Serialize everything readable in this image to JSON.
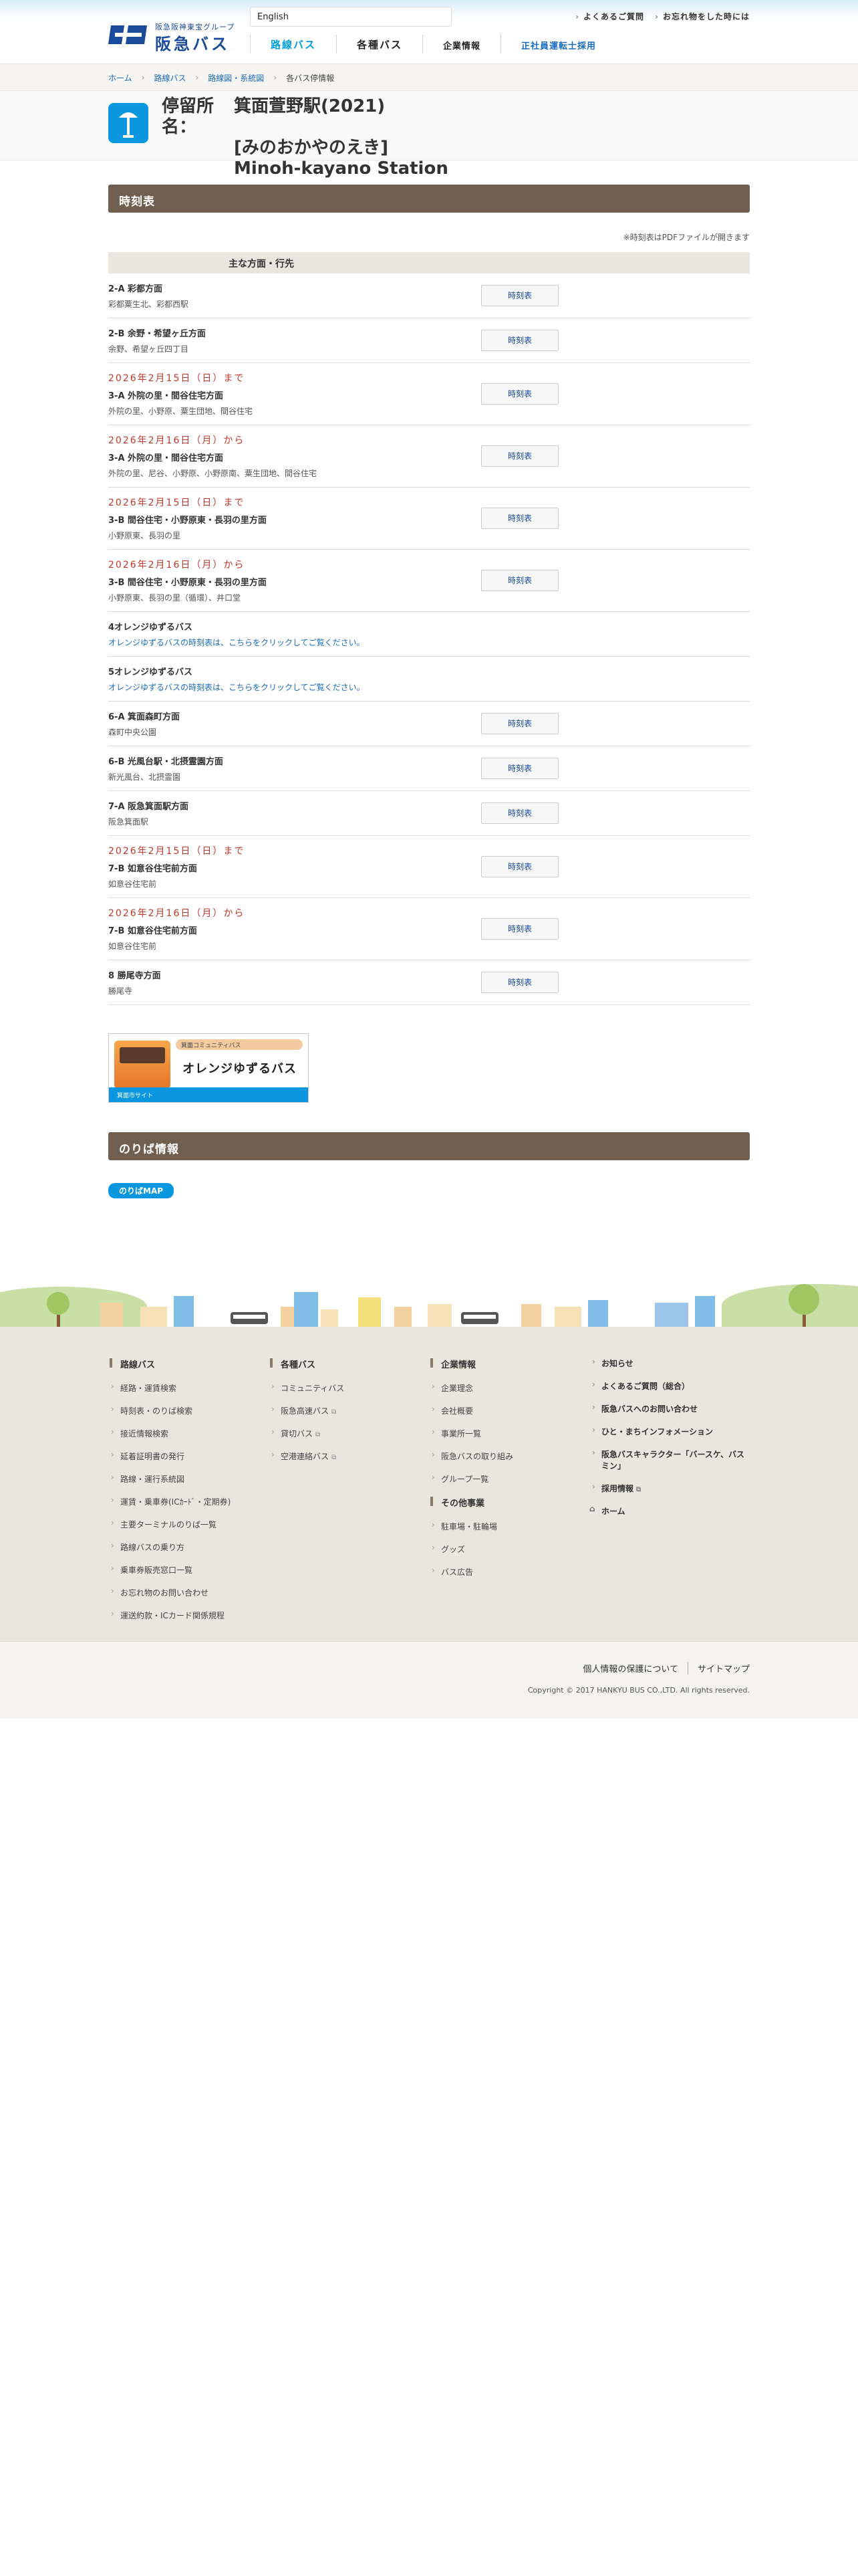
{
  "header": {
    "logo_sub": "阪急阪神東宝グループ",
    "logo_name": "阪急バス",
    "logo_mark": "HANKYU",
    "language": "English",
    "top_links": [
      "よくあるご質問",
      "お忘れ物をした時には"
    ],
    "nav": [
      "路線バス",
      "各種バス",
      "企業情報",
      "正社員運転士採用"
    ]
  },
  "breadcrumb": [
    "ホーム",
    "路線バス",
    "路線図・系統図",
    "各バス停情報"
  ],
  "stop": {
    "prefix": "停留所名：",
    "name": "箕面萱野駅(2021)",
    "kana": "[みのおかやのえき]",
    "english": "Minoh-kayano Station"
  },
  "timetable": {
    "heading": "時刻表",
    "pdf_note": "※時刻表はPDFファイルが開きます",
    "col_header": "主な方面・行先",
    "button_label": "時刻表",
    "rows": [
      {
        "date": "",
        "route": "2-A 彩都方面",
        "stops": "彩都粟生北、彩都西駅",
        "button": true
      },
      {
        "date": "",
        "route": "2-B 余野・希望ヶ丘方面",
        "stops": "余野、希望ヶ丘四丁目",
        "button": true
      },
      {
        "date": "2026年2月15日（日）まで",
        "route": "3-A 外院の里・間谷住宅方面",
        "stops": "外院の里、小野原、粟生団地、間谷住宅",
        "button": true
      },
      {
        "date": "2026年2月16日（月）から",
        "route": "3-A 外院の里・間谷住宅方面",
        "stops": "外院の里、尼谷、小野原、小野原南、粟生団地、間谷住宅",
        "button": true
      },
      {
        "date": "2026年2月15日（日）まで",
        "route": "3-B 間谷住宅・小野原東・長羽の里方面",
        "stops": "小野原東、長羽の里",
        "button": true
      },
      {
        "date": "2026年2月16日（月）から",
        "route": "3-B 間谷住宅・小野原東・長羽の里方面",
        "stops": "小野原東、長羽の里（循環）、井口堂",
        "button": true
      },
      {
        "date": "",
        "route": "4オレンジゆずるバス",
        "stops": "",
        "orange": "オレンジゆずるバスの時刻表は、こちらをクリックしてご覧ください。",
        "button": false
      },
      {
        "date": "",
        "route": "5オレンジゆずるバス",
        "stops": "",
        "orange": "オレンジゆずるバスの時刻表は、こちらをクリックしてご覧ください。",
        "button": false
      },
      {
        "date": "",
        "route": "6-A 箕面森町方面",
        "stops": "森町中央公園",
        "button": true
      },
      {
        "date": "",
        "route": "6-B 光風台駅・北摂霊園方面",
        "stops": "新光風台、北摂霊園",
        "button": true
      },
      {
        "date": "",
        "route": "7-A 阪急箕面駅方面",
        "stops": "阪急箕面駅",
        "button": true
      },
      {
        "date": "2026年2月15日（日）まで",
        "route": "7-B 如意谷住宅前方面",
        "stops": "如意谷住宅前",
        "button": true
      },
      {
        "date": "2026年2月16日（月）から",
        "route": "7-B 如意谷住宅前方面",
        "stops": "如意谷住宅前",
        "button": true
      },
      {
        "date": "",
        "route": "8 勝尾寺方面",
        "stops": "勝尾寺",
        "button": true
      }
    ]
  },
  "banner": {
    "tag": "箕面コミュニティバス",
    "name": "オレンジゆずるバス",
    "foot": "箕面市サイト"
  },
  "noriba": {
    "heading": "のりば情報",
    "button": "のりばMAP"
  },
  "footer": {
    "col1": {
      "head": "路線バス",
      "items": [
        "経路・運賃検索",
        "時刻表・のりば検索",
        "接近情報検索",
        "延着証明書の発行",
        "路線・運行系統図",
        "運賃・乗車券(ICｶｰﾄﾞ・定期券)",
        "主要ターミナルのりば一覧",
        "路線バスの乗り方",
        "乗車券販売窓口一覧",
        "お忘れ物のお問い合わせ",
        "運送約款・ICカード関係規程"
      ]
    },
    "col2": {
      "head": "各種バス",
      "items": [
        "コミュニティバス",
        "阪急高速バス",
        "貸切バス",
        "空港連絡バス"
      ],
      "ext": "外部"
    },
    "col3": {
      "head": "企業情報",
      "items": [
        "企業理念",
        "会社概要",
        "事業所一覧",
        "阪急バスの取り組み",
        "グループ一覧"
      ],
      "head2": "その他事業",
      "items2": [
        "駐車場・駐輪場",
        "グッズ",
        "バス広告"
      ]
    },
    "col4": {
      "items": [
        "お知らせ",
        "よくあるご質問（総合）",
        "阪急バスへのお問い合わせ",
        "ひと・まちインフォメーション",
        "阪急バスキャラクター「バースケ、バスミン」",
        "採用情報"
      ],
      "home": "ホーム"
    },
    "bottom_links": [
      "個人情報の保護について",
      "サイトマップ"
    ],
    "copyright": "Copyright © 2017 HANKYU BUS CO.,LTD. All rights reserved."
  }
}
